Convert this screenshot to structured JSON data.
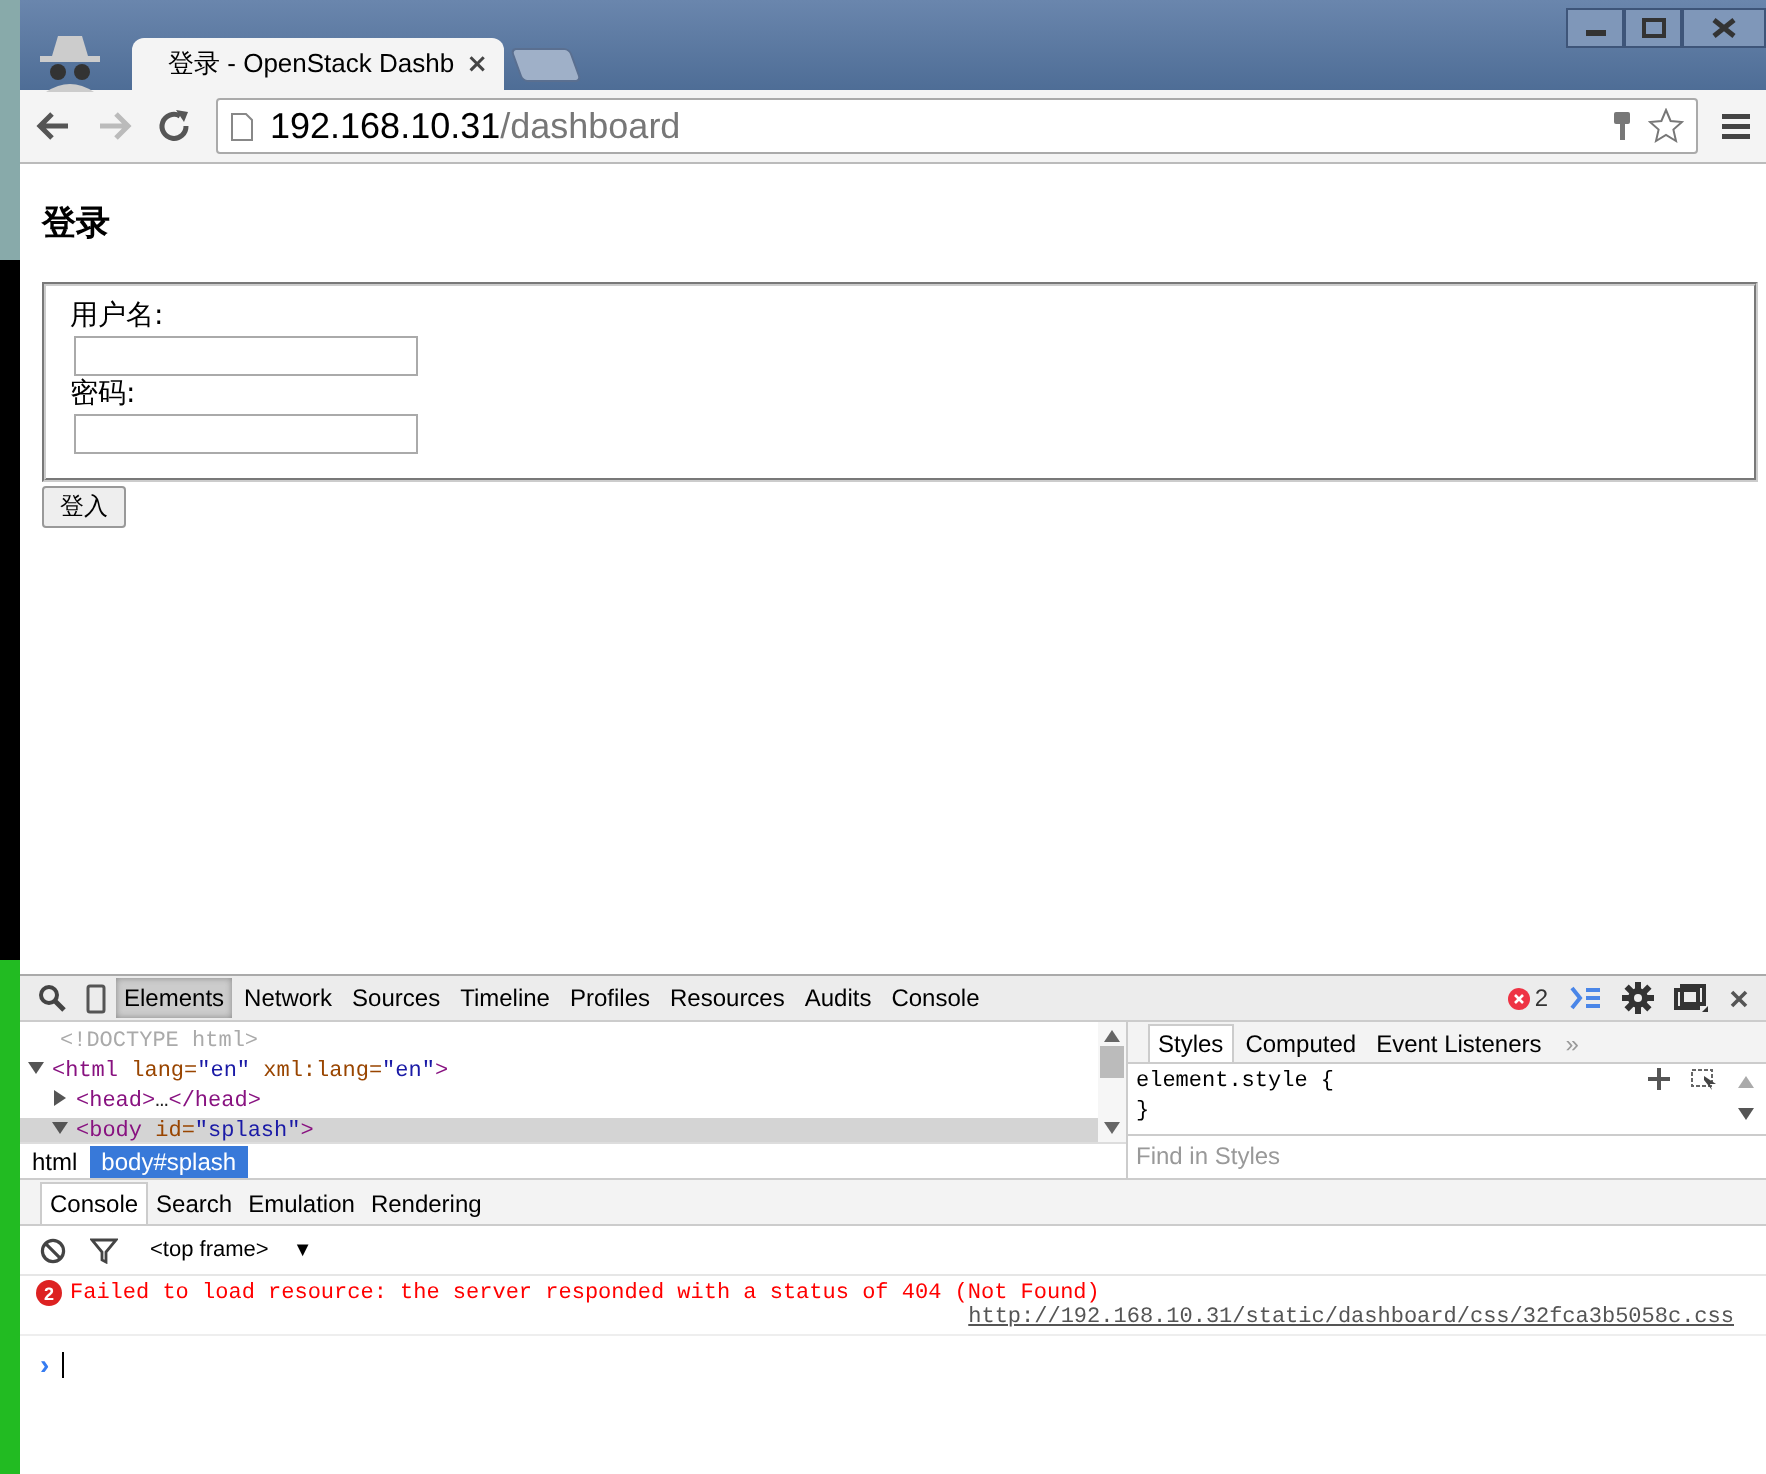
{
  "browser": {
    "tab": {
      "title": "登录 - OpenStack Dashb",
      "close": "×"
    },
    "address": {
      "host": "192.168.10.31",
      "path": "/dashboard"
    }
  },
  "page": {
    "heading": "登录",
    "fields": [
      {
        "label": "用户名:"
      },
      {
        "label": "密码:"
      }
    ],
    "submit": "登入"
  },
  "devtools": {
    "tabs": [
      {
        "label": "Elements",
        "selected": true
      },
      {
        "label": "Network",
        "selected": false
      },
      {
        "label": "Sources",
        "selected": false
      },
      {
        "label": "Timeline",
        "selected": false
      },
      {
        "label": "Profiles",
        "selected": false
      },
      {
        "label": "Resources",
        "selected": false
      },
      {
        "label": "Audits",
        "selected": false
      },
      {
        "label": "Console",
        "selected": false
      }
    ],
    "error_count": "2",
    "dom": [
      {
        "kind": "doctype",
        "selected": false,
        "tokens": [
          {
            "kind": "muted",
            "text": "<!DOCTYPE html>"
          }
        ]
      },
      {
        "kind": "node",
        "expanded": true,
        "selected": false,
        "tokens": [
          {
            "kind": "tag",
            "text": "<html"
          },
          {
            "kind": "attr",
            "text": " lang="
          },
          {
            "kind": "value",
            "text": "\"en\""
          },
          {
            "kind": "attr",
            "text": " xml:lang="
          },
          {
            "kind": "value",
            "text": "\"en\""
          },
          {
            "kind": "tag",
            "text": ">"
          }
        ]
      },
      {
        "kind": "child",
        "expanded": false,
        "selected": false,
        "tokens": [
          {
            "kind": "tag",
            "text": "<head>"
          },
          {
            "kind": "plain",
            "text": "…"
          },
          {
            "kind": "tag",
            "text": "</head>"
          }
        ]
      },
      {
        "kind": "child",
        "expanded": true,
        "selected": true,
        "tokens": [
          {
            "kind": "tag",
            "text": "<body"
          },
          {
            "kind": "attr",
            "text": " id="
          },
          {
            "kind": "value",
            "text": "\"splash\""
          },
          {
            "kind": "tag",
            "text": ">"
          }
        ]
      }
    ],
    "breadcrumbs": [
      {
        "label": "html",
        "selected": false
      },
      {
        "label": "body#splash",
        "selected": true
      }
    ],
    "style_tabs": [
      {
        "label": "Styles",
        "selected": true
      },
      {
        "label": "Computed",
        "selected": false
      },
      {
        "label": "Event Listeners",
        "selected": false
      }
    ],
    "style_more": "»",
    "style_rule": [
      "element.style {",
      "}"
    ],
    "style_filter": {
      "placeholder": "Find in Styles"
    },
    "drawer_tabs": [
      {
        "label": "Console",
        "selected": true
      },
      {
        "label": "Search",
        "selected": false
      },
      {
        "label": "Emulation",
        "selected": false
      },
      {
        "label": "Rendering",
        "selected": false
      }
    ],
    "frame": "<top frame>",
    "frame_caret": "▼",
    "messages": [
      {
        "count": "2",
        "text": "Failed to load resource: the server responded with a status of 404 (Not Found)",
        "source": "http://192.168.10.31/static/dashboard/css/32fca3b5058c.css"
      }
    ],
    "prompt": "›"
  }
}
